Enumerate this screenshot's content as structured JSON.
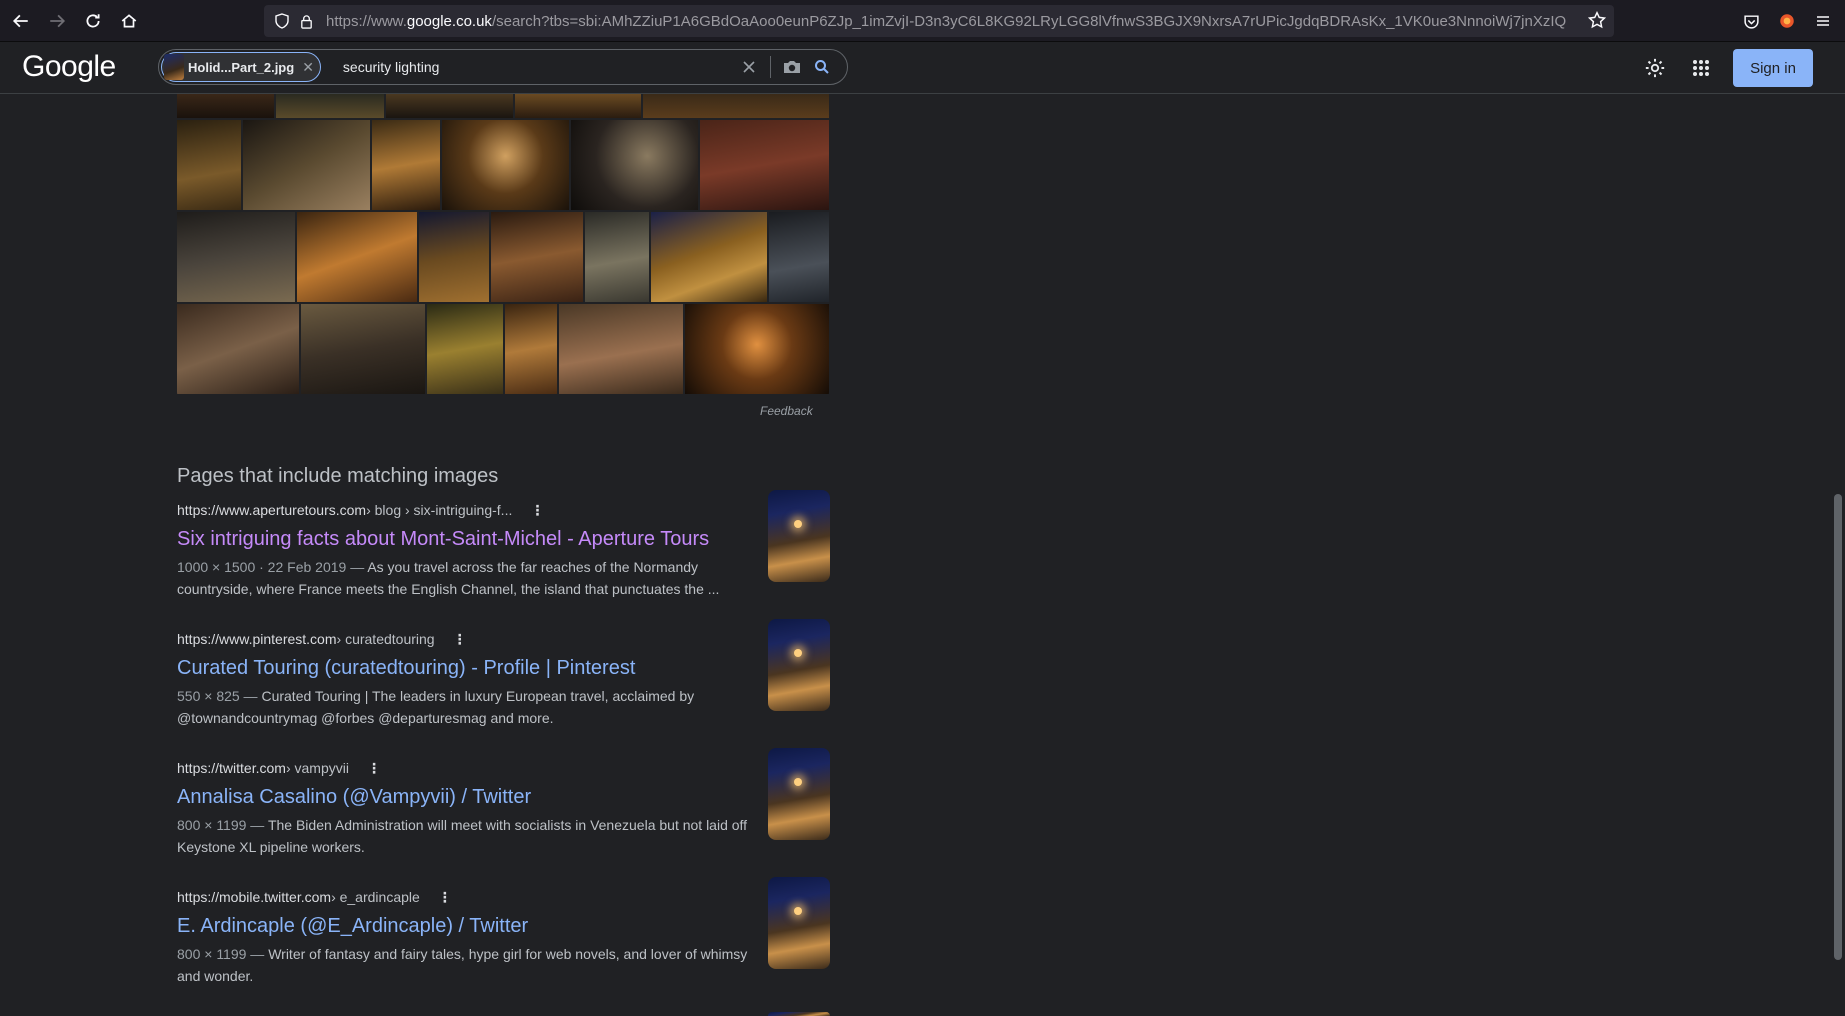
{
  "browser": {
    "url_host_prefix": "https://www.",
    "url_host": "google.co.uk",
    "url_rest": "/search?tbs=sbi:AMhZZiuP1A6GBdOaAoo0eunP6ZJp_1imZvjI-D3n3yC6L8KG92LRyLGG8lVfnwS3BGJX9NxrsA7rUPicJgdqBDRAsKx_1VK0ue3NnnoiWj7jnXzIQ"
  },
  "header": {
    "logo": "Google",
    "chip_label": "Holid...Part_2.jpg",
    "query": "security lighting",
    "signin_label": "Sign in"
  },
  "image_grid": {
    "feedback_label": "Feedback"
  },
  "section_title": "Pages that include matching images",
  "results": [
    {
      "url": "https://www.aperturetours.com",
      "path": " › blog › six-intriguing-f...",
      "title": "Six intriguing facts about Mont-Saint-Michel - Aperture Tours",
      "meta": "1000 × 1500 · 22 Feb 2019 — ",
      "desc": "As you travel across the far reaches of the Normandy countryside, where France meets the English Channel, the island that punctuates the ...",
      "visited": true
    },
    {
      "url": "https://www.pinterest.com",
      "path": " › curatedtouring",
      "title": "Curated Touring (curatedtouring) - Profile | Pinterest",
      "meta": "550 × 825 — ",
      "desc": "Curated Touring | The leaders in luxury European travel, acclaimed by @townandcountrymag @forbes @departuresmag and more.",
      "visited": false
    },
    {
      "url": "https://twitter.com",
      "path": " › vampyvii",
      "title": "Annalisa Casalino (@Vampyvii) / Twitter",
      "meta": "800 × 1199 — ",
      "desc": "The Biden Administration will meet with socialists in Venezuela but not laid off Keystone XL pipeline workers.",
      "visited": false
    },
    {
      "url": "https://mobile.twitter.com",
      "path": " › e_ardincaple",
      "title": "E. Ardincaple (@E_Ardincaple) / Twitter",
      "meta": "800 × 1199 — ",
      "desc": "Writer of fantasy and fairy tales, hype girl for web novels, and lover of whimsy and wonder.",
      "visited": false
    }
  ]
}
